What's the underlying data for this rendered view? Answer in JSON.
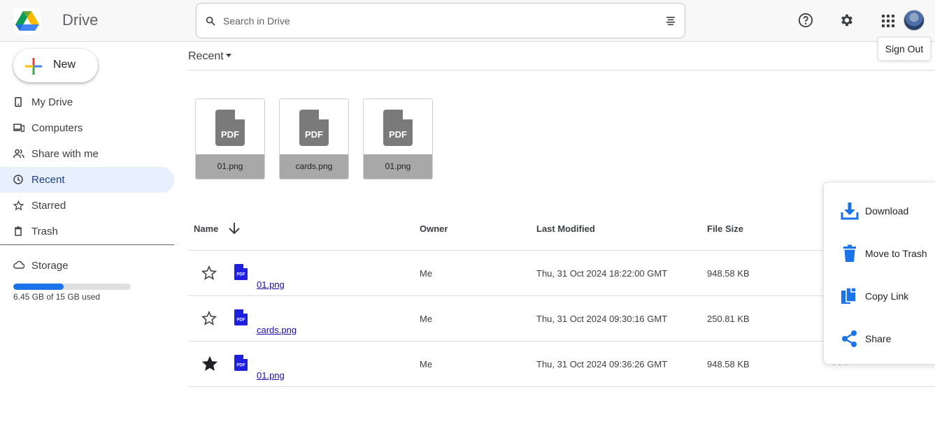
{
  "header": {
    "app_name": "Drive",
    "search_placeholder": "Search in Drive",
    "sign_out_label": "Sign Out"
  },
  "sidebar": {
    "new_label": "New",
    "items": [
      {
        "label": "My Drive",
        "icon": "phone-icon"
      },
      {
        "label": "Computers",
        "icon": "devices-icon"
      },
      {
        "label": "Share with me",
        "icon": "people-icon"
      },
      {
        "label": "Recent",
        "icon": "clock-icon",
        "active": true
      },
      {
        "label": "Starred",
        "icon": "star-outline-icon"
      },
      {
        "label": "Trash",
        "icon": "trash-icon"
      }
    ],
    "storage": {
      "label": "Storage",
      "used_text": "6.45 GB of 15 GB used",
      "used_fraction": 0.43
    }
  },
  "main": {
    "section_title": "Recent",
    "recent_files": [
      {
        "name": "01.png"
      },
      {
        "name": "cards.png"
      },
      {
        "name": "01.png"
      }
    ],
    "table": {
      "headers": {
        "name": "Name",
        "owner": "Owner",
        "modified": "Last Modified",
        "size": "File Size"
      },
      "rows": [
        {
          "name": "01.png",
          "owner": "Me",
          "modified": "Thu, 31 Oct 2024 18:22:00 GMT",
          "size": "948.58 KB",
          "starred": false
        },
        {
          "name": "cards.png",
          "owner": "Me",
          "modified": "Thu, 31 Oct 2024 09:30:16 GMT",
          "size": "250.81 KB",
          "starred": false
        },
        {
          "name": "01.png",
          "owner": "Me",
          "modified": "Thu, 31 Oct 2024 09:36:26 GMT",
          "size": "948.58 KB",
          "starred": true
        }
      ]
    }
  },
  "context_menu": {
    "items": [
      {
        "label": "Download",
        "icon": "download-icon"
      },
      {
        "label": "Move to Trash",
        "icon": "trash-icon"
      },
      {
        "label": "Copy Link",
        "icon": "copy-icon"
      },
      {
        "label": "Share",
        "icon": "share-icon"
      }
    ]
  },
  "colors": {
    "accent": "#1a73e8",
    "active_nav_bg": "#e8f0fe",
    "pdf_blue": "#1f1fe0",
    "pdf_gray": "#7a7a7a"
  }
}
